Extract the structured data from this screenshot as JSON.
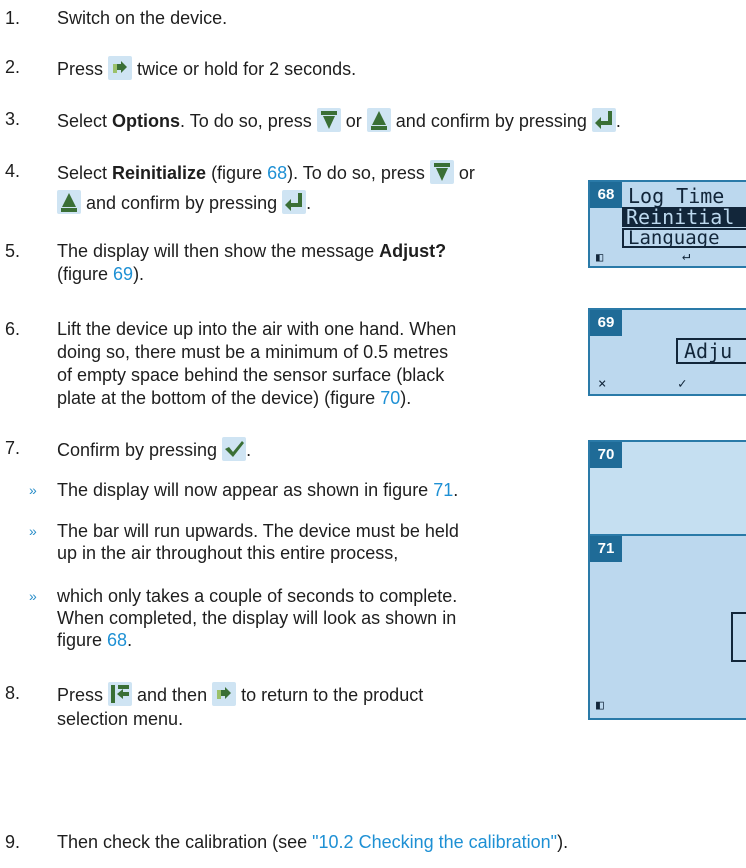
{
  "steps": [
    {
      "num": "1.",
      "text": "Switch on the device."
    },
    {
      "num": "2.",
      "pre": "Press ",
      "post": " twice or hold for 2 seconds."
    },
    {
      "num": "3.",
      "pre": "Select ",
      "bold": "Options",
      "mid": ". To do so, press ",
      "or": " or ",
      "and": " and confirm by pressing ",
      "end": "."
    },
    {
      "num": "4.",
      "pre": "Select ",
      "bold": "Reinitialize",
      "mid": " (figure ",
      "fig": "68",
      "mid2": "). To do so, press ",
      "or": " or",
      "line2": " and confirm by pressing ",
      "end": "."
    },
    {
      "num": "5.",
      "line1_pre": "The display will then show the message ",
      "bold": "Adjust?",
      "line2_pre": "(figure ",
      "fig": "69",
      "line2_post": ")."
    },
    {
      "num": "6.",
      "line1": "Lift the device up into the air with one hand. When",
      "line2": "doing so, there must be a minimum of 0.5 metres",
      "line3": "of empty space behind the sensor surface (black",
      "line4_pre": "plate at the bottom of the device) (figure ",
      "fig": "70",
      "line4_post": ")."
    },
    {
      "num": "7.",
      "pre": "Confirm by pressing ",
      "end": "."
    },
    {
      "num": "8.",
      "pre": "Press ",
      "mid": " and then ",
      "post": " to return to the product",
      "line2": "selection menu."
    },
    {
      "num": "9.",
      "pre": "Then check the calibration (see ",
      "link": "\"10.2 Checking the calibration\"",
      "post": ")."
    }
  ],
  "bullets": [
    {
      "mark": "»",
      "pre": "The display will now appear as shown in figure ",
      "fig": "71",
      "post": "."
    },
    {
      "mark": "»",
      "line1": "The bar will run upwards. The device must be held",
      "line2": "up in the air throughout this entire process,"
    },
    {
      "mark": "»",
      "line1": "which only takes a couple of seconds to complete.",
      "line2": "When completed, the display will look as shown in",
      "line3_pre": "figure ",
      "fig": "68",
      "line3_post": "."
    }
  ],
  "figures": [
    {
      "num": "68",
      "lines": [
        "Log Time",
        "Reinitial",
        "Language"
      ],
      "footer": [
        "◧",
        "↵"
      ]
    },
    {
      "num": "69",
      "message": "Adju",
      "footer": [
        "×",
        "✓"
      ]
    },
    {
      "num": "70"
    },
    {
      "num": "71",
      "footer": [
        "◧"
      ]
    }
  ],
  "icons": {
    "menu": "menu-icon",
    "down": "arrow-down-icon",
    "up": "arrow-up-icon",
    "enter": "enter-icon",
    "check": "check-icon",
    "back": "back-icon"
  },
  "colors": {
    "link": "#1e90d4",
    "figure_header": "#1f6b97",
    "lcd": "#bcd8ee"
  }
}
